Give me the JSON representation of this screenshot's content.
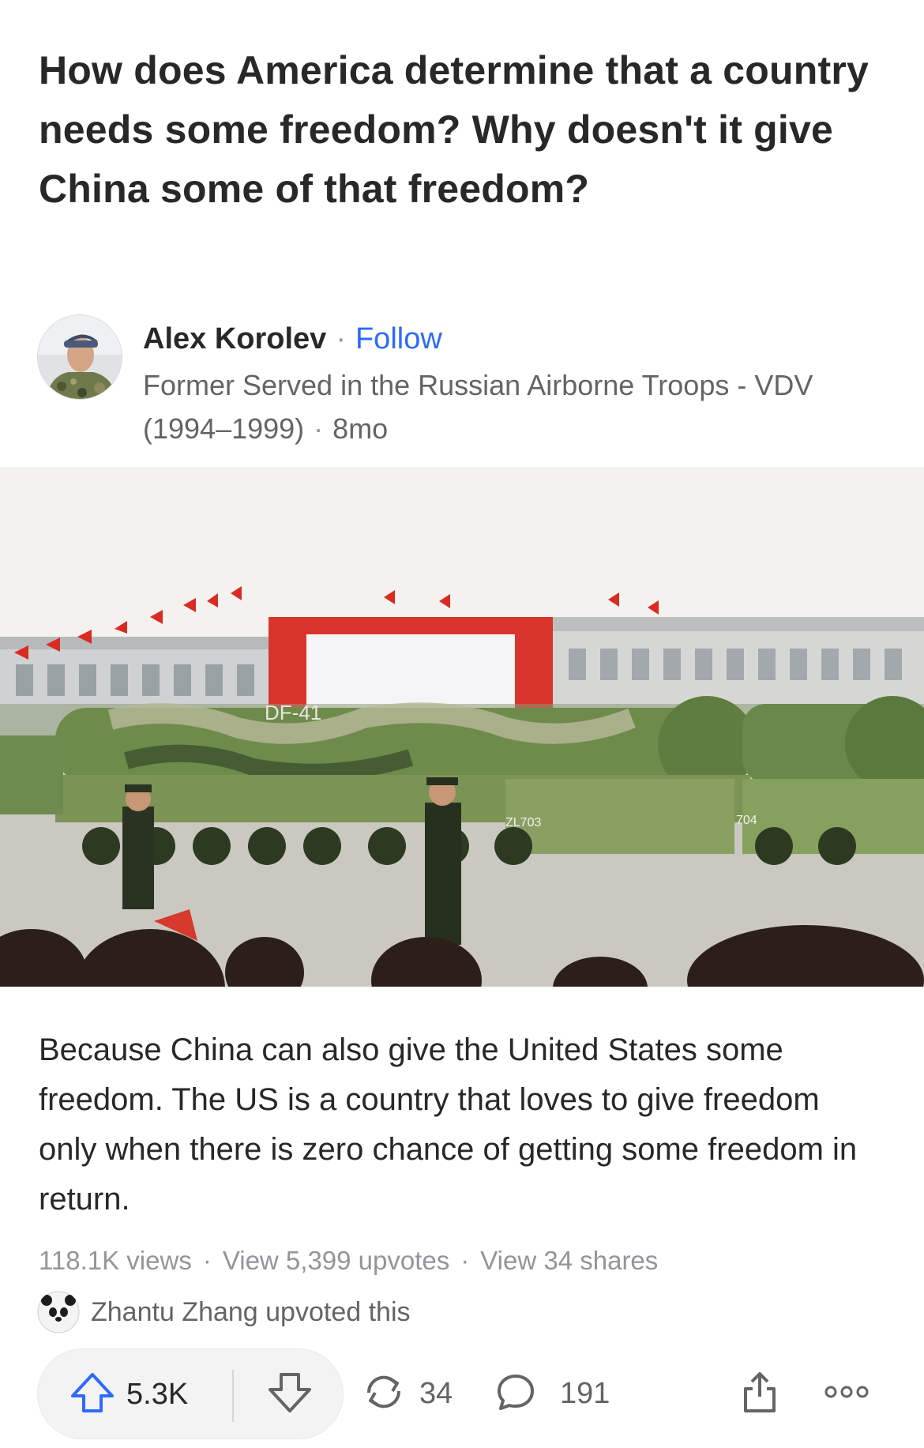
{
  "question": {
    "title": "How does America determine that a country needs some freedom? Why doesn't it give China some of that freedom?"
  },
  "author": {
    "name": "Alex Korolev",
    "follow_label": "Follow",
    "credential": "Former Served in the Russian Airborne Troops - VDV (1994–1999)",
    "time": "8mo"
  },
  "photo": {
    "vehicle_label_1": "DF-41",
    "vehicle_label_2": "ZL703",
    "vehicle_label_3": "704"
  },
  "answer": {
    "text": "Because China can also give the United States some freedom. The US is a country that loves to give freedom only when there is zero chance of getting some freedom in return."
  },
  "stats": {
    "views": "118.1K views",
    "upvotes": "View 5,399 upvotes",
    "shares": "View 34 shares"
  },
  "upvoted_by": {
    "text": "Zhantu Zhang upvoted this"
  },
  "actions": {
    "upvote_count": "5.3K",
    "share_count": "34",
    "comment_count": "191"
  },
  "colors": {
    "accent": "#2e69ff",
    "text_primary": "#282829",
    "text_secondary": "#636466",
    "text_muted": "#939598"
  }
}
